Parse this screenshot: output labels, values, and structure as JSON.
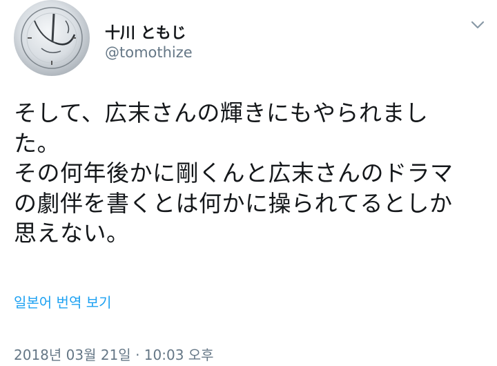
{
  "tweet": {
    "author": {
      "display_name": "十川 ともじ",
      "handle": "@tomothize",
      "avatar_icon": "clock-avatar-icon"
    },
    "menu_icon": "chevron-down-icon",
    "text_lines": [
      "そして、広末さんの輝きにもやられまし",
      "た。",
      "その何年後かに剛くんと広末さんのドラマ",
      "の劇伴を書くとは何かに操られてるとしか",
      "思えない。"
    ],
    "translate_label": "일본어 번역 보기",
    "timestamp": "2018년 03월 21일 · 10:03 오후",
    "colors": {
      "link": "#1da1f2",
      "secondary": "#657786",
      "primary_text": "#14171a"
    }
  }
}
